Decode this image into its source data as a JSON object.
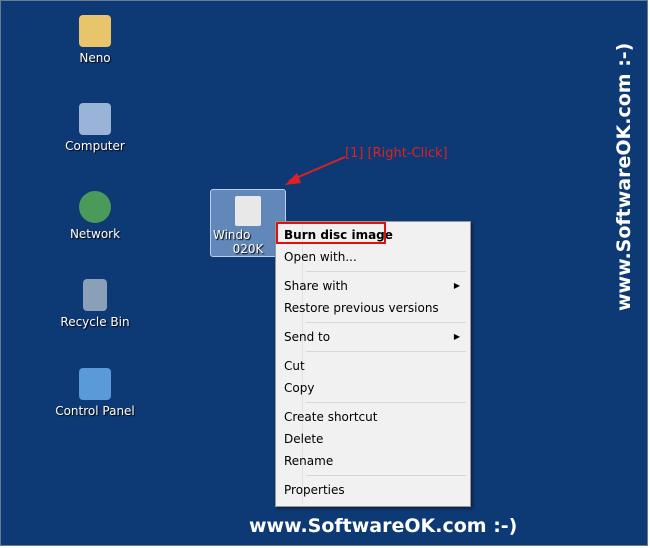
{
  "desktop": {
    "icons": [
      {
        "label": "Neno",
        "icon": "user-folder-icon"
      },
      {
        "label": "Computer",
        "icon": "computer-icon"
      },
      {
        "label": "Network",
        "icon": "network-icon"
      },
      {
        "label": "Recycle Bin",
        "icon": "recycle-bin-icon"
      },
      {
        "label": "Control Panel",
        "icon": "control-panel-icon"
      }
    ],
    "selected_file": {
      "line1": "Windo",
      "line2": "020K",
      "icon": "disc-image-icon"
    }
  },
  "annotation": "[1] [Right-Click]",
  "context_menu": {
    "items": [
      {
        "label": "Burn disc image",
        "bold": true
      },
      {
        "label": "Open with..."
      },
      {
        "label": "Share with",
        "submenu": true
      },
      {
        "label": "Restore previous versions"
      },
      {
        "label": "Send to",
        "submenu": true
      },
      {
        "label": "Cut"
      },
      {
        "label": "Copy"
      },
      {
        "label": "Create shortcut"
      },
      {
        "label": "Delete"
      },
      {
        "label": "Rename"
      },
      {
        "label": "Properties"
      }
    ]
  },
  "watermark": "www.SoftwareOK.com :-)",
  "colors": {
    "desktop": "#0d3a75",
    "highlight": "#e01010"
  }
}
